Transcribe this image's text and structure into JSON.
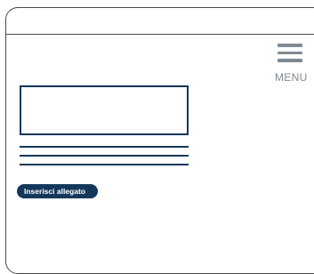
{
  "header": {
    "menu_label": "MENU",
    "menu_icon": "hamburger-menu-icon"
  },
  "form": {
    "input_value": "",
    "attach_button_label": "Inserisci allegato"
  },
  "colors": {
    "primary": "#14385c",
    "menu_gray": "#7f8a93",
    "frame_border": "#4a4a4a"
  }
}
